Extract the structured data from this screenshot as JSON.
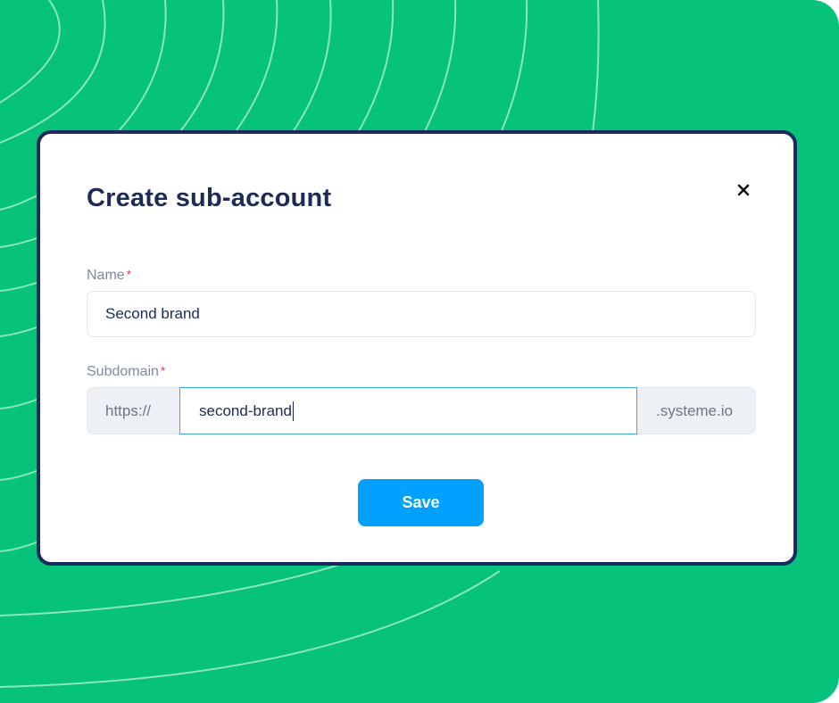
{
  "modal": {
    "title": "Create sub-account",
    "close_icon": "close-icon",
    "name_field": {
      "label": "Name",
      "required_marker": "*",
      "value": "Second brand"
    },
    "subdomain_field": {
      "label": "Subdomain",
      "required_marker": "*",
      "prefix": "https://",
      "value": "second-brand",
      "suffix": ".systeme.io"
    },
    "save_label": "Save"
  },
  "colors": {
    "background": "#06c27a",
    "title": "#1d2b57",
    "button": "#03a1ff",
    "required": "#e0245e",
    "focus_border": "#3aa3e6"
  }
}
